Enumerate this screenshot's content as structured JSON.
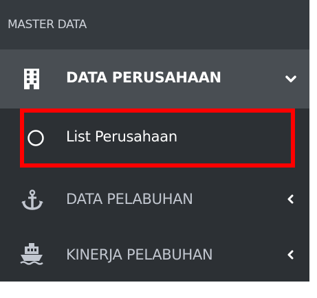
{
  "sidebar": {
    "header": "MASTER DATA",
    "items": [
      {
        "label": "DATA PERUSAHAAN",
        "icon": "building-icon",
        "expanded": true,
        "children": [
          {
            "label": "List Perusahaan",
            "icon": "circle-outline-icon"
          }
        ]
      },
      {
        "label": "DATA PELABUHAN",
        "icon": "anchor-icon",
        "expanded": false
      },
      {
        "label": "KINERJA PELABUHAN",
        "icon": "ship-icon",
        "expanded": false
      }
    ]
  },
  "colors": {
    "sidebar_bg": "#2c3034",
    "header_bg": "#353a3f",
    "active_bg": "#494e53",
    "highlight": "#ff0000",
    "text_muted": "#c2c7d0",
    "text_active": "#ffffff"
  }
}
